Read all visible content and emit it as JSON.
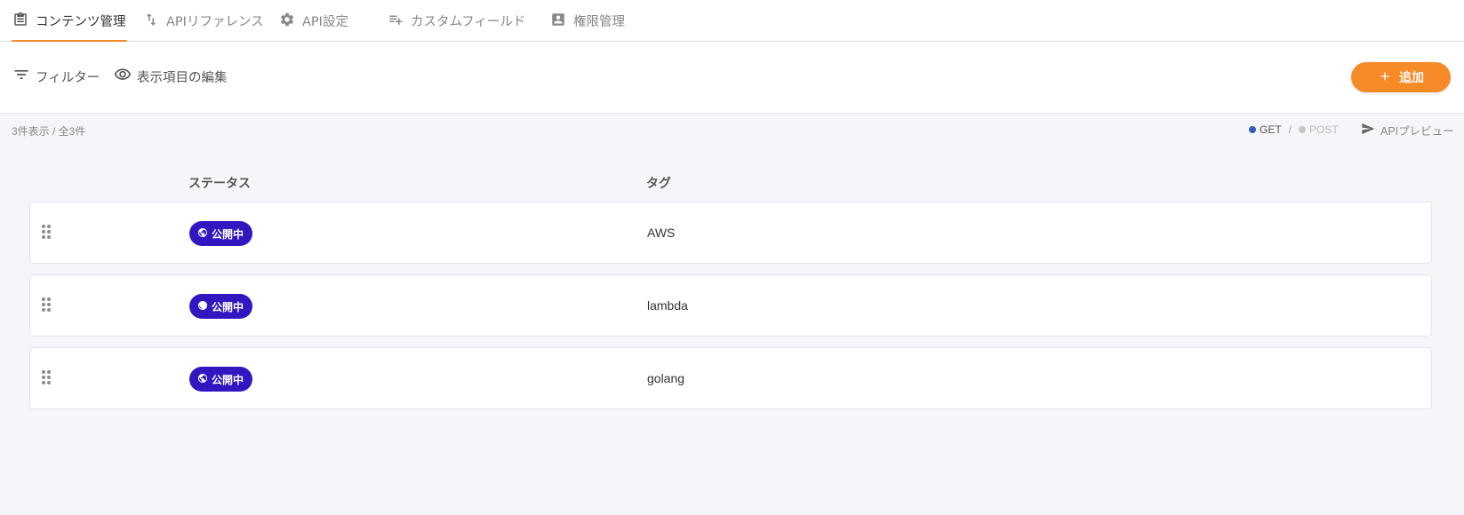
{
  "tabs": [
    {
      "label": "コンテンツ管理",
      "icon": "clipboard-icon",
      "active": true
    },
    {
      "label": "APIリファレンス",
      "icon": "swap-vertical-icon",
      "active": false
    },
    {
      "label": "API設定",
      "icon": "gear-icon",
      "active": false
    },
    {
      "label": "カスタムフィールド",
      "icon": "playlist-add-icon",
      "active": false
    },
    {
      "label": "権限管理",
      "icon": "account-box-icon",
      "active": false
    }
  ],
  "toolbar": {
    "filter_label": "フィルター",
    "columns_label": "表示項目の編集",
    "add_label": "追加"
  },
  "meta": {
    "count_text": "3件表示 / 全3件",
    "get_label": "GET",
    "separator": "/",
    "post_label": "POST",
    "api_preview_label": "APIプレビュー"
  },
  "table": {
    "headers": {
      "status": "ステータス",
      "tag": "タグ"
    },
    "rows": [
      {
        "status": "公開中",
        "tag": "AWS"
      },
      {
        "status": "公開中",
        "tag": "lambda"
      },
      {
        "status": "公開中",
        "tag": "golang"
      }
    ]
  },
  "colors": {
    "accent": "#f58a26",
    "status_published": "#3217c0",
    "get_active": "#2f5fb8",
    "post_inactive": "#c8c8c8"
  }
}
